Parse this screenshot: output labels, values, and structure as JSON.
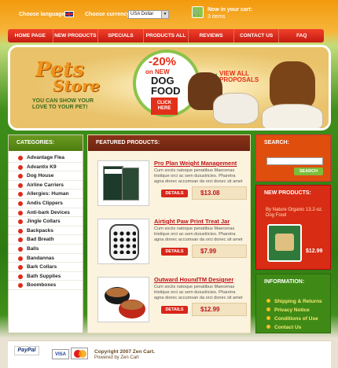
{
  "topbar": {
    "language_label": "Choose language:",
    "currency_label": "Choose currency:",
    "currency_value": "USA Dollar",
    "cart_label": "Now in your cart:",
    "cart_count": "3 items"
  },
  "nav": [
    "HOME PAGE",
    "NEW PRODUCTS",
    "SPECIALS",
    "PRODUCTS ALL",
    "REVIEWS",
    "CONTACT US",
    "FAQ"
  ],
  "banner": {
    "logo_line1": "Pets",
    "logo_line2": "Store",
    "tagline": "YOU CAN SHOW YOUR LOVE TO YOUR PET!",
    "promo_percent": "-20%",
    "promo_on": "on NEW",
    "promo_dog": "DOG",
    "promo_food": "FOOD",
    "click_here": "CLICK HERE",
    "view_all": "VIEW ALL PROPOSALS"
  },
  "categories": {
    "title": "CATEGORIES:",
    "items": [
      "Advantage Flea",
      "Advantix K9",
      "Dog House",
      "Airline Carriers",
      "Allergies: Human",
      "Andis Clippers",
      "Anti-bark Devices",
      "Jingle Collars",
      "Backpacks",
      "Bad Breath",
      "Balls",
      "Bandannas",
      "Bark Collars",
      "Bath Supplies",
      "Boomboxes"
    ]
  },
  "featured": {
    "title": "FEATURED PRODUCTS:",
    "details_label": "DETAILS",
    "products": [
      {
        "name": "Pro Plan Weight Management",
        "desc": "Cum sociis natoque penatibus Maecenas tristique orci ac sem duiuslricies. Pharetra agna donec accumsan da orci donec sit amet",
        "price": "$13.08"
      },
      {
        "name": "Airtight Paw Print Treat Jar",
        "desc": "Cum sociis natoque penatibus Maecenas tristique orci ac sem duiuslricies. Pharetra agna donec accumsan da orci donec sit amet",
        "price": "$7.99"
      },
      {
        "name": "Outward HoundTM Designer",
        "desc": "Cum sociis natoque penatibus Maecenas tristique orci ac sem duiuslricies. Pharetra agna donec accumsan da orci donec sit amet",
        "price": "$12.99"
      }
    ]
  },
  "search": {
    "title": "SEARCH:",
    "button": "SEARCH"
  },
  "new_products": {
    "title": "NEW PRODUCTS:",
    "name": "By Nature Organic 13.2-oz. Dog Food",
    "price": "$12.99"
  },
  "information": {
    "title": "INFORMATION:",
    "items": [
      "Shipping & Returns",
      "Privacy Notice",
      "Conditions of Use",
      "Contact Us"
    ]
  },
  "footer": {
    "paypal": "PayPal",
    "visa": "VISA",
    "copyright": "Copyright 2007 Zen Cart.",
    "powered": "Powered by Zen Cart"
  },
  "colors": {
    "accent_red": "#d9261a",
    "green": "#3f8a16",
    "orange": "#f39a0e"
  }
}
